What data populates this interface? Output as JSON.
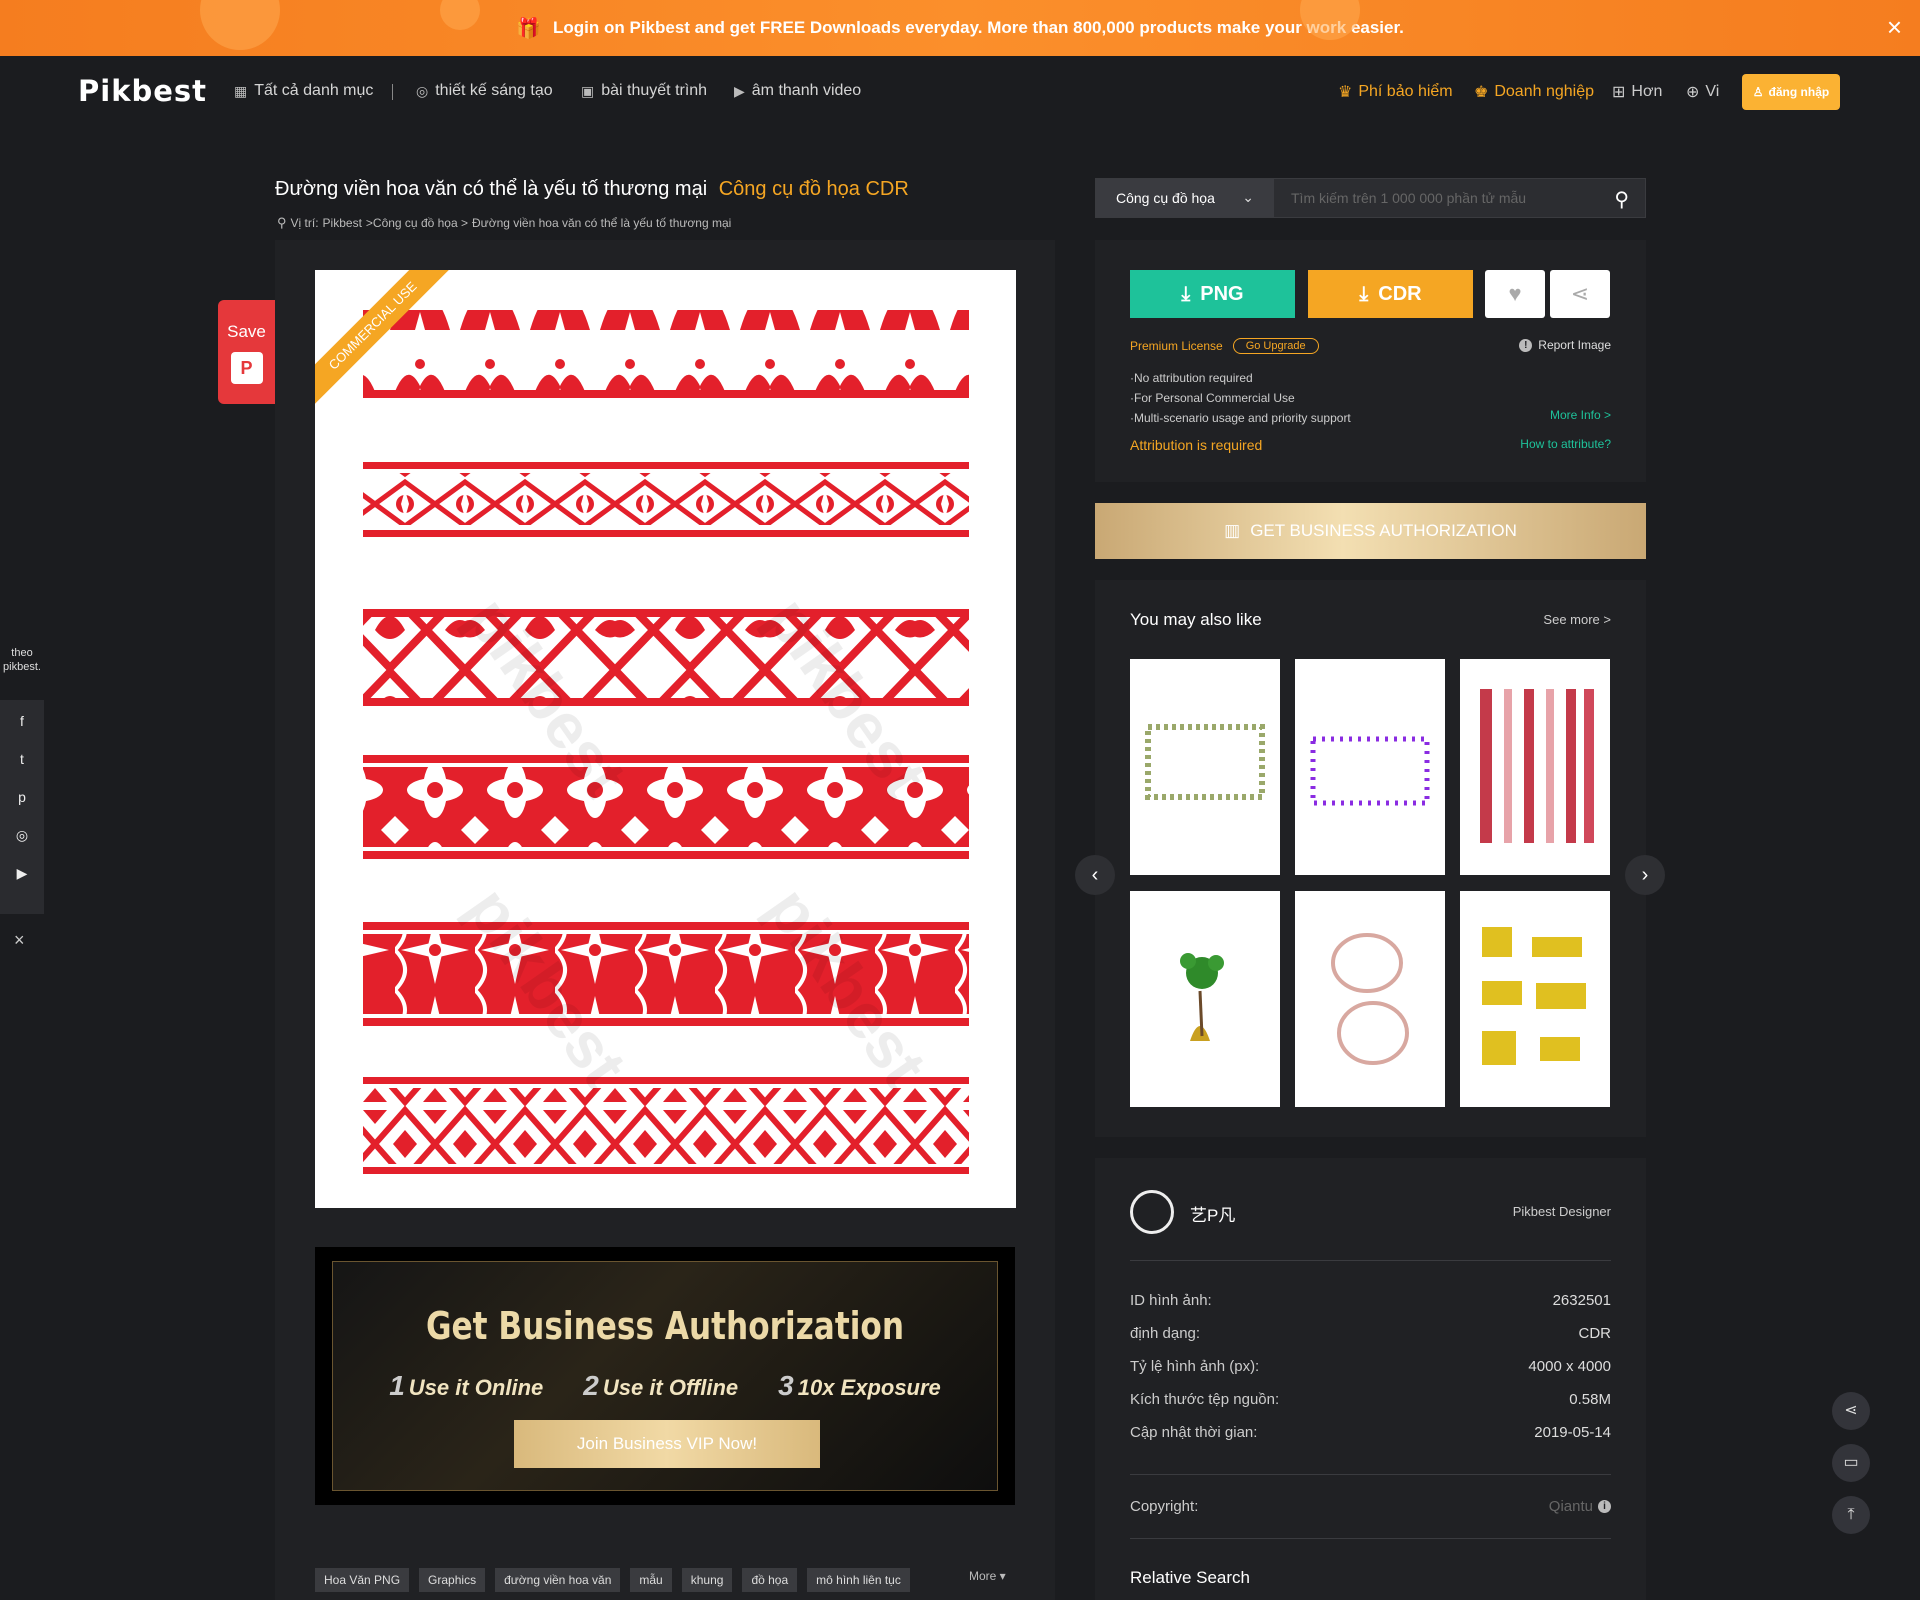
{
  "promo": {
    "text": "Login on Pikbest and get FREE Downloads everyday. More than 800,000 products make your work easier.",
    "close": "×"
  },
  "nav": {
    "logo": "Pikbest",
    "all_categories": "Tất cả danh mục",
    "creative_design": "thiết kế sáng tạo",
    "presentation": "bài thuyết trình",
    "audio_video": "âm thanh video",
    "premium": "Phí bảo hiểm",
    "business": "Doanh nghiệp",
    "more": "Hơn",
    "language": "Vi",
    "login": "đăng nhập"
  },
  "page": {
    "title": "Đường viền hoa văn có thể là yếu tố thương mại",
    "category": "Công cụ đồ họa CDR",
    "breadcrumb": {
      "label": "Vị trí:",
      "home": "Pikbest",
      "section": ">Công cụ đồ họa >",
      "current": "Đường viền hoa văn có thể là yếu tố thương mại"
    }
  },
  "search": {
    "category": "Công cụ đồ họa",
    "placeholder": "Tìm kiếm trên 1 000 000 phần tử mẫu"
  },
  "preview": {
    "ribbon": "COMMERCIAL USE",
    "watermark": "pikbest"
  },
  "save": {
    "label": "Save",
    "pin": "P"
  },
  "follow": {
    "line1": "theo",
    "line2": "pikbest."
  },
  "social_close": "×",
  "biz_banner": {
    "title": "Get Business Authorization",
    "features": [
      {
        "num": "1",
        "label": "Use it Online"
      },
      {
        "num": "2",
        "label": "Use it Offline"
      },
      {
        "num": "3",
        "label": "10x Exposure"
      }
    ],
    "button": "Join Business VIP Now!"
  },
  "tags": [
    "Hoa Văn PNG",
    "Graphics",
    "đường viền hoa văn",
    "mẫu",
    "khung",
    "đồ họa",
    "mô hình liên tục"
  ],
  "tags_more": "More ▾",
  "download": {
    "png": "PNG",
    "cdr": "CDR",
    "premium_license": "Premium License",
    "go_upgrade": "Go Upgrade",
    "report": "Report Image",
    "benefits": [
      "·No attribution required",
      "·For Personal Commercial Use",
      "·Multi-scenario usage and priority support"
    ],
    "more_info": "More Info >",
    "attribution": "Attribution is required",
    "how_attribute": "How to attribute?"
  },
  "get_business": "GET BUSINESS AUTHORIZATION",
  "also_like": {
    "title": "You may also like",
    "see_more": "See more >"
  },
  "author": {
    "name": "艺P凡",
    "role": "Pikbest Designer"
  },
  "info": [
    {
      "label": "ID hình ảnh:",
      "value": "2632501"
    },
    {
      "label": "định dạng:",
      "value": "CDR"
    },
    {
      "label": "Tỷ lệ hình ảnh (px):",
      "value": "4000 x 4000"
    },
    {
      "label": "Kích thước tệp nguồn:",
      "value": "0.58M"
    },
    {
      "label": "Cập nhật thời gian:",
      "value": "2019-05-14"
    }
  ],
  "copyright": {
    "label": "Copyright:",
    "value": "Qiantu"
  },
  "relative_search": "Relative Search",
  "colors": {
    "accent": "#f5a623",
    "green": "#1ec29a",
    "pattern_red": "#e3202b",
    "bg": "#1b1c1f"
  }
}
